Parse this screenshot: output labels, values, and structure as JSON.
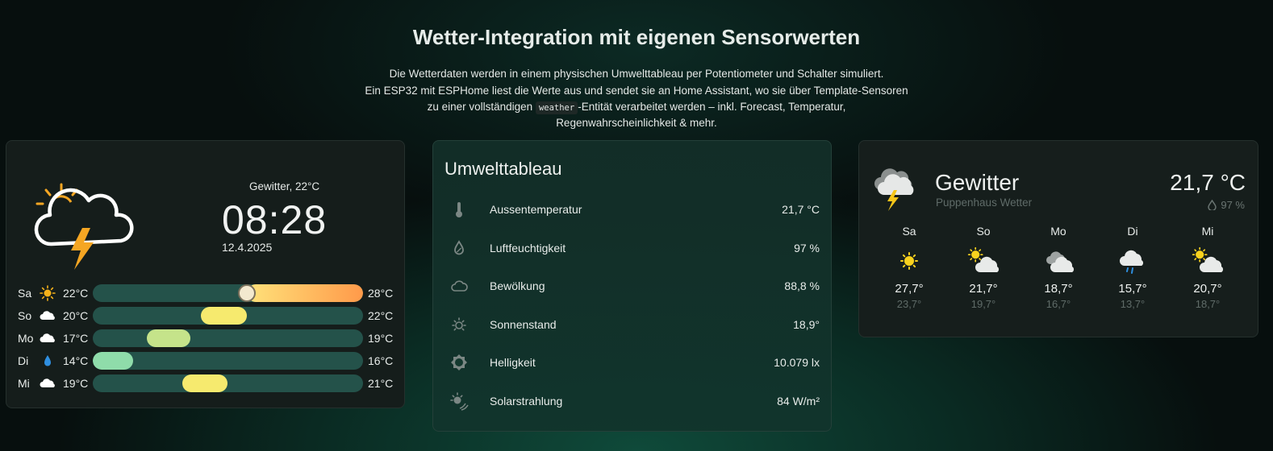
{
  "header": {
    "title": "Wetter-Integration mit eigenen Sensorwerten",
    "line1": "Die Wetterdaten werden in einem physischen Umwelttableau per Potentiometer und Schalter simuliert.",
    "line2": "Ein ESP32 mit ESPHome liest die Werte aus und sendet sie an Home Assistant, wo sie über Template-Sensoren",
    "line3_pre": "zu einer vollständigen ",
    "line3_code": "weather",
    "line3_post": "-Entität verarbeitet werden – inkl. Forecast, Temperatur,",
    "line4": "Regenwahrscheinlichkeit & mehr."
  },
  "clock_card": {
    "condition_line": "Gewitter, 22°C",
    "time": "08:28",
    "date": "12.4.2025",
    "main_icon": "thunderstorm-icon",
    "forecast": [
      {
        "day": "Sa",
        "icon": "sun-icon",
        "low": "22°C",
        "high": "28°C",
        "range": [
          0.57,
          1.0
        ],
        "color": "sunny"
      },
      {
        "day": "So",
        "icon": "cloud-icon",
        "low": "20°C",
        "high": "22°C",
        "range": [
          0.4,
          0.57
        ],
        "color": "yellow"
      },
      {
        "day": "Mo",
        "icon": "cloud-icon",
        "low": "17°C",
        "high": "19°C",
        "range": [
          0.2,
          0.36
        ],
        "color": "lime"
      },
      {
        "day": "Di",
        "icon": "raindrop-icon",
        "low": "14°C",
        "high": "16°C",
        "range": [
          0.0,
          0.15
        ],
        "color": "mint"
      },
      {
        "day": "Mi",
        "icon": "cloud-icon",
        "low": "19°C",
        "high": "21°C",
        "range": [
          0.33,
          0.5
        ],
        "color": "yellow"
      }
    ],
    "current_marker": 0.57
  },
  "sensor_card": {
    "title": "Umwelttableau",
    "rows": [
      {
        "icon": "thermometer-icon",
        "label": "Aussentemperatur",
        "value": "21,7 °C"
      },
      {
        "icon": "humidity-icon",
        "label": "Luftfeuchtigkeit",
        "value": "97 %"
      },
      {
        "icon": "cloud-icon",
        "label": "Bewölkung",
        "value": "88,8 %"
      },
      {
        "icon": "sun-elevation-icon",
        "label": "Sonnenstand",
        "value": "18,9°"
      },
      {
        "icon": "brightness-icon",
        "label": "Helligkeit",
        "value": "10.079 lx"
      },
      {
        "icon": "solar-radiation-icon",
        "label": "Solarstrahlung",
        "value": "84 W/m²"
      }
    ]
  },
  "weather_card": {
    "condition": "Gewitter",
    "subtitle": "Puppenhaus Wetter",
    "temperature": "21,7 °C",
    "humidity": "97 %",
    "forecast": [
      {
        "day": "Sa",
        "icon": "sunny-icon",
        "high": "27,7°",
        "low": "23,7°"
      },
      {
        "day": "So",
        "icon": "partly-cloudy-icon",
        "high": "21,7°",
        "low": "19,7°"
      },
      {
        "day": "Mo",
        "icon": "cloudy-icon",
        "high": "18,7°",
        "low": "16,7°"
      },
      {
        "day": "Di",
        "icon": "rainy-icon",
        "high": "15,7°",
        "low": "13,7°"
      },
      {
        "day": "Mi",
        "icon": "partly-cloudy-icon",
        "high": "20,7°",
        "low": "18,7°"
      }
    ]
  },
  "colors": {
    "sunny_gradient": [
      "#ffe27a",
      "#ff9a4a"
    ],
    "yellow": "#f6ea6e",
    "lime": "#c5e38a",
    "mint": "#8fdcaa",
    "track": "#24524a",
    "bolt": "#f5a623"
  }
}
